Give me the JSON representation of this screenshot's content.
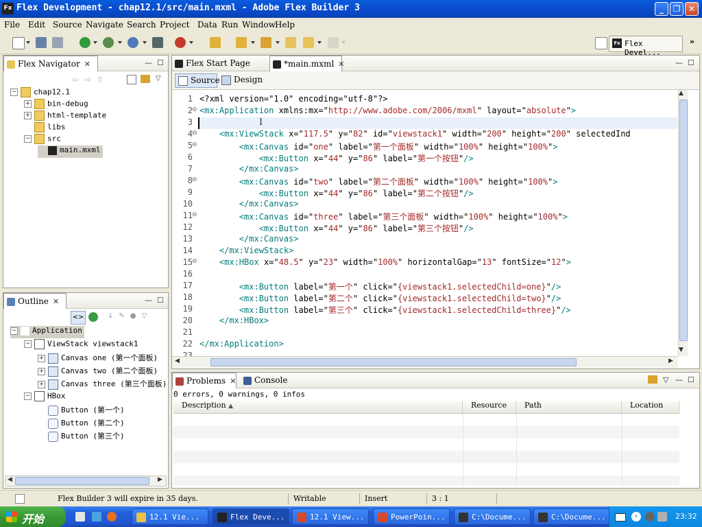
{
  "window": {
    "app_icon": "Fx",
    "title": "Flex Development - chap12.1/src/main.mxml - Adobe Flex Builder 3",
    "minimize": "_",
    "maximize": "❐",
    "close": "✕"
  },
  "menu": [
    "File",
    "Edit",
    "Source",
    "Navigate",
    "Search",
    "Project",
    "Data",
    "Run",
    "Window",
    "Help"
  ],
  "perspective": {
    "label": "Flex Devel..."
  },
  "navigator": {
    "tab": "Flex Navigator",
    "items": [
      {
        "label": "chap12.1",
        "level": 0,
        "expander": "−",
        "icon": "project-folder"
      },
      {
        "label": "bin-debug",
        "level": 1,
        "expander": "+",
        "icon": "folder"
      },
      {
        "label": "html-template",
        "level": 1,
        "expander": "+",
        "icon": "folder"
      },
      {
        "label": "libs",
        "level": 1,
        "expander": "",
        "icon": "folder"
      },
      {
        "label": "src",
        "level": 1,
        "expander": "−",
        "icon": "folder"
      },
      {
        "label": "main.mxml",
        "level": 2,
        "expander": "",
        "icon": "mxml-file",
        "selected": true
      }
    ]
  },
  "outline": {
    "tab": "Outline",
    "items": [
      {
        "label": "Application",
        "level": 0,
        "expander": "−",
        "icon": "application",
        "selected": true
      },
      {
        "label": "ViewStack viewstack1",
        "level": 1,
        "expander": "−",
        "icon": "viewstack"
      },
      {
        "label": "Canvas one (第一个面板)",
        "level": 2,
        "expander": "+",
        "icon": "canvas"
      },
      {
        "label": "Canvas two (第二个面板)",
        "level": 2,
        "expander": "+",
        "icon": "canvas"
      },
      {
        "label": "Canvas three (第三个面板)",
        "level": 2,
        "expander": "+",
        "icon": "canvas"
      },
      {
        "label": "HBox",
        "level": 1,
        "expander": "−",
        "icon": "hbox"
      },
      {
        "label": "Button (第一个)",
        "level": 2,
        "expander": "",
        "icon": "button"
      },
      {
        "label": "Button (第二个)",
        "level": 2,
        "expander": "",
        "icon": "button"
      },
      {
        "label": "Button (第三个)",
        "level": 2,
        "expander": "",
        "icon": "button"
      }
    ]
  },
  "editor": {
    "tabs": [
      {
        "label": "Flex Start Page",
        "active": false
      },
      {
        "label": "*main.mxml",
        "active": true
      }
    ],
    "modes": {
      "source": "Source",
      "design": "Design"
    },
    "lines": [
      {
        "n": "1",
        "fold": "",
        "segs": [
          [
            "t",
            "<?xml version=\"1.0\" encoding=\"utf-8\"?>"
          ]
        ]
      },
      {
        "n": "2",
        "fold": "⊖",
        "segs": [
          [
            "g",
            "<mx:Application "
          ],
          [
            "t",
            "xmlns:mx=\""
          ],
          [
            "v",
            "http://www.adobe.com/2006/mxml"
          ],
          [
            "t",
            "\" layout=\""
          ],
          [
            "v",
            "absolute"
          ],
          [
            "t",
            "\""
          ],
          [
            "g",
            ">"
          ]
        ]
      },
      {
        "n": "3",
        "fold": "",
        "segs": [],
        "current": true
      },
      {
        "n": "4",
        "fold": "⊖",
        "segs": [
          [
            "t",
            "    "
          ],
          [
            "g",
            "<mx:ViewStack "
          ],
          [
            "t",
            "x=\""
          ],
          [
            "v",
            "117.5"
          ],
          [
            "t",
            "\" y=\""
          ],
          [
            "v",
            "82"
          ],
          [
            "t",
            "\" id=\""
          ],
          [
            "v",
            "viewstack1"
          ],
          [
            "t",
            "\" width=\""
          ],
          [
            "v",
            "200"
          ],
          [
            "t",
            "\" height=\""
          ],
          [
            "v",
            "200"
          ],
          [
            "t",
            "\" selectedInd"
          ]
        ]
      },
      {
        "n": "5",
        "fold": "⊖",
        "segs": [
          [
            "t",
            "        "
          ],
          [
            "g",
            "<mx:Canvas "
          ],
          [
            "t",
            "id=\""
          ],
          [
            "v",
            "one"
          ],
          [
            "t",
            "\" label=\""
          ],
          [
            "v",
            "第一个面板"
          ],
          [
            "t",
            "\" width=\""
          ],
          [
            "v",
            "100%"
          ],
          [
            "t",
            "\" height=\""
          ],
          [
            "v",
            "100%"
          ],
          [
            "t",
            "\""
          ],
          [
            "g",
            ">"
          ]
        ]
      },
      {
        "n": "6",
        "fold": "",
        "segs": [
          [
            "t",
            "            "
          ],
          [
            "g",
            "<mx:Button "
          ],
          [
            "t",
            "x=\""
          ],
          [
            "v",
            "44"
          ],
          [
            "t",
            "\" y=\""
          ],
          [
            "v",
            "86"
          ],
          [
            "t",
            "\" label=\""
          ],
          [
            "v",
            "第一个按钮"
          ],
          [
            "t",
            "\""
          ],
          [
            "g",
            "/>"
          ]
        ]
      },
      {
        "n": "7",
        "fold": "",
        "segs": [
          [
            "t",
            "        "
          ],
          [
            "g",
            "</mx:Canvas>"
          ]
        ]
      },
      {
        "n": "8",
        "fold": "⊖",
        "segs": [
          [
            "t",
            "        "
          ],
          [
            "g",
            "<mx:Canvas "
          ],
          [
            "t",
            "id=\""
          ],
          [
            "v",
            "two"
          ],
          [
            "t",
            "\" label=\""
          ],
          [
            "v",
            "第二个面板"
          ],
          [
            "t",
            "\" width=\""
          ],
          [
            "v",
            "100%"
          ],
          [
            "t",
            "\" height=\""
          ],
          [
            "v",
            "100%"
          ],
          [
            "t",
            "\""
          ],
          [
            "g",
            ">"
          ]
        ]
      },
      {
        "n": "9",
        "fold": "",
        "segs": [
          [
            "t",
            "            "
          ],
          [
            "g",
            "<mx:Button "
          ],
          [
            "t",
            "x=\""
          ],
          [
            "v",
            "44"
          ],
          [
            "t",
            "\" y=\""
          ],
          [
            "v",
            "86"
          ],
          [
            "t",
            "\" label=\""
          ],
          [
            "v",
            "第二个按钮"
          ],
          [
            "t",
            "\""
          ],
          [
            "g",
            "/>"
          ]
        ]
      },
      {
        "n": "10",
        "fold": "",
        "segs": [
          [
            "t",
            "        "
          ],
          [
            "g",
            "</mx:Canvas>"
          ]
        ]
      },
      {
        "n": "11",
        "fold": "⊖",
        "segs": [
          [
            "t",
            "        "
          ],
          [
            "g",
            "<mx:Canvas "
          ],
          [
            "t",
            "id=\""
          ],
          [
            "v",
            "three"
          ],
          [
            "t",
            "\" label=\""
          ],
          [
            "v",
            "第三个面板"
          ],
          [
            "t",
            "\" width=\""
          ],
          [
            "v",
            "100%"
          ],
          [
            "t",
            "\" height=\""
          ],
          [
            "v",
            "100%"
          ],
          [
            "t",
            "\""
          ],
          [
            "g",
            ">"
          ]
        ]
      },
      {
        "n": "12",
        "fold": "",
        "segs": [
          [
            "t",
            "            "
          ],
          [
            "g",
            "<mx:Button "
          ],
          [
            "t",
            "x=\""
          ],
          [
            "v",
            "44"
          ],
          [
            "t",
            "\" y=\""
          ],
          [
            "v",
            "86"
          ],
          [
            "t",
            "\" label=\""
          ],
          [
            "v",
            "第三个按钮"
          ],
          [
            "t",
            "\""
          ],
          [
            "g",
            "/>"
          ]
        ]
      },
      {
        "n": "13",
        "fold": "",
        "segs": [
          [
            "t",
            "        "
          ],
          [
            "g",
            "</mx:Canvas>"
          ]
        ]
      },
      {
        "n": "14",
        "fold": "",
        "segs": [
          [
            "t",
            "    "
          ],
          [
            "g",
            "</mx:ViewStack>"
          ]
        ]
      },
      {
        "n": "15",
        "fold": "⊖",
        "segs": [
          [
            "t",
            "    "
          ],
          [
            "g",
            "<mx:HBox "
          ],
          [
            "t",
            "x=\""
          ],
          [
            "v",
            "48.5"
          ],
          [
            "t",
            "\" y=\""
          ],
          [
            "v",
            "23"
          ],
          [
            "t",
            "\" width=\""
          ],
          [
            "v",
            "100%"
          ],
          [
            "t",
            "\" horizontalGap=\""
          ],
          [
            "v",
            "13"
          ],
          [
            "t",
            "\" fontSize=\""
          ],
          [
            "v",
            "12"
          ],
          [
            "t",
            "\""
          ],
          [
            "g",
            ">"
          ]
        ]
      },
      {
        "n": "16",
        "fold": "",
        "segs": []
      },
      {
        "n": "17",
        "fold": "",
        "segs": [
          [
            "t",
            "        "
          ],
          [
            "g",
            "<mx:Button "
          ],
          [
            "t",
            "label=\""
          ],
          [
            "v",
            "第一个"
          ],
          [
            "t",
            "\" click=\""
          ],
          [
            "v",
            "{viewstack1.selectedChild=one}"
          ],
          [
            "t",
            "\""
          ],
          [
            "g",
            "/>"
          ]
        ]
      },
      {
        "n": "18",
        "fold": "",
        "segs": [
          [
            "t",
            "        "
          ],
          [
            "g",
            "<mx:Button "
          ],
          [
            "t",
            "label=\""
          ],
          [
            "v",
            "第二个"
          ],
          [
            "t",
            "\" click=\""
          ],
          [
            "v",
            "{viewstack1.selectedChild=two}"
          ],
          [
            "t",
            "\""
          ],
          [
            "g",
            "/>"
          ]
        ]
      },
      {
        "n": "19",
        "fold": "",
        "segs": [
          [
            "t",
            "        "
          ],
          [
            "g",
            "<mx:Button "
          ],
          [
            "t",
            "label=\""
          ],
          [
            "v",
            "第三个"
          ],
          [
            "t",
            "\" click=\""
          ],
          [
            "v",
            "{viewstack1.selectedChild=three}"
          ],
          [
            "t",
            "\""
          ],
          [
            "g",
            "/>"
          ]
        ]
      },
      {
        "n": "20",
        "fold": "",
        "segs": [
          [
            "t",
            "    "
          ],
          [
            "g",
            "</mx:HBox>"
          ]
        ]
      },
      {
        "n": "21",
        "fold": "",
        "segs": []
      },
      {
        "n": "22",
        "fold": "",
        "segs": [
          [
            "g",
            "</mx:Application>"
          ]
        ]
      },
      {
        "n": "23",
        "fold": "",
        "segs": []
      }
    ]
  },
  "problems": {
    "tabs": [
      {
        "label": "Problems",
        "active": true
      },
      {
        "label": "Console",
        "active": false
      }
    ],
    "summary": "0 errors, 0 warnings, 0 infos",
    "columns": [
      "Description",
      "Resource",
      "Path",
      "Location"
    ]
  },
  "status": {
    "message": "Flex Builder 3 will expire in 35 days.",
    "mode": "Writable",
    "insert": "Insert",
    "position": "3 : 1"
  },
  "taskbar": {
    "start": "开始",
    "tasks": [
      {
        "label": "12.1 Vie...",
        "icon_color": "#e9c24a",
        "active": false
      },
      {
        "label": "Flex Deve...",
        "icon_color": "#222222",
        "active": true
      },
      {
        "label": "12.1 View...",
        "icon_color": "#d9472b",
        "active": false
      },
      {
        "label": "PowerPoin...",
        "icon_color": "#d9472b",
        "active": false
      },
      {
        "label": "C:\\Docume...",
        "icon_color": "#333333",
        "active": false
      },
      {
        "label": "C:\\Docume...",
        "icon_color": "#333333",
        "active": false
      }
    ],
    "clock": "23:32"
  }
}
